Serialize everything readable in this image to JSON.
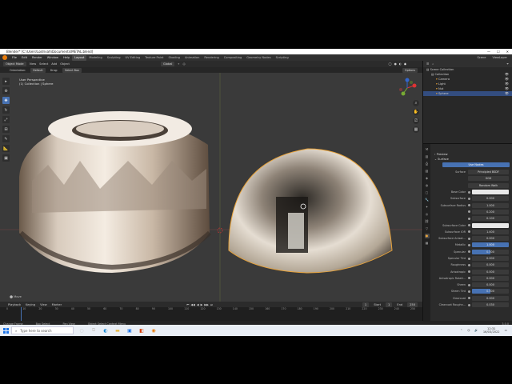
{
  "window": {
    "title": "Blender* [C:\\Users\\Lodrivah\\Documents\\METAL.blend]"
  },
  "menu": {
    "items": [
      "File",
      "Edit",
      "Render",
      "Window",
      "Help"
    ],
    "workspaces": [
      "Layout",
      "Modeling",
      "Sculpting",
      "UV Editing",
      "Texture Paint",
      "Shading",
      "Animation",
      "Rendering",
      "Compositing",
      "Geometry Nodes",
      "Scripting"
    ],
    "active_workspace": "Layout",
    "scene": "Scene",
    "view_layer": "ViewLayer"
  },
  "viewport_header": {
    "mode": "Object Mode",
    "menus": [
      "View",
      "Select",
      "Add",
      "Object"
    ],
    "transform": "Global",
    "options": "Options"
  },
  "tool_header": {
    "orientation": "Orientation:",
    "orientation_value": "Default",
    "drag": "Drag:",
    "drag_value": "Select Box"
  },
  "viewport": {
    "perspective": "User Perspective",
    "collection": "(1) Collection | Sphere",
    "mouse_label": "Move"
  },
  "outliner": {
    "root": "Scene Collection",
    "items": [
      {
        "label": "Collection",
        "indent": 1
      },
      {
        "label": "Camera",
        "indent": 2
      },
      {
        "label": "Light",
        "indent": 2
      },
      {
        "label": "Nut",
        "indent": 2
      },
      {
        "label": "Sphere",
        "indent": 2,
        "selected": true
      }
    ]
  },
  "properties": {
    "preview": "Preview",
    "surface_section": "Surface",
    "use_nodes": "Use Nodes",
    "surface": {
      "label": "Surface",
      "value": "Principled BSDF"
    },
    "distribution": "GGX",
    "subsurface_method": "Random Walk",
    "rows": [
      {
        "label": "Base Color",
        "value": "",
        "type": "white"
      },
      {
        "label": "Subsurface",
        "value": "0.000",
        "type": "dark"
      },
      {
        "label": "Subsurface Radius",
        "value": "1.000",
        "type": "dark"
      },
      {
        "label": "",
        "value": "0.200",
        "type": "dark"
      },
      {
        "label": "",
        "value": "0.100",
        "type": "dark"
      },
      {
        "label": "Subsurface Color",
        "value": "",
        "type": "white"
      },
      {
        "label": "Subsurface IOR",
        "value": "1.400",
        "type": "dark"
      },
      {
        "label": "Subsurface Anisot...",
        "value": "0.000",
        "type": "dark"
      },
      {
        "label": "Metallic",
        "value": "1.000",
        "type": "blue"
      },
      {
        "label": "Specular",
        "value": "0.500",
        "type": "half"
      },
      {
        "label": "Specular Tint",
        "value": "0.000",
        "type": "dark"
      },
      {
        "label": "Roughness",
        "value": "0.000",
        "type": "dark"
      },
      {
        "label": "Anisotropic",
        "value": "0.000",
        "type": "dark"
      },
      {
        "label": "Anisotropic Rotati...",
        "value": "0.000",
        "type": "dark"
      },
      {
        "label": "Sheen",
        "value": "0.000",
        "type": "dark"
      },
      {
        "label": "Sheen Tint",
        "value": "0.500",
        "type": "half"
      },
      {
        "label": "Clearcoat",
        "value": "0.000",
        "type": "dark"
      },
      {
        "label": "Clearcoat Roughn...",
        "value": "0.030",
        "type": "dark"
      }
    ]
  },
  "timeline": {
    "menus": [
      "Playback",
      "Keying",
      "View",
      "Marker"
    ],
    "current_frame": "1",
    "start_label": "Start",
    "start": "1",
    "end_label": "End",
    "end": "250",
    "ticks": [
      "0",
      "10",
      "20",
      "30",
      "40",
      "50",
      "60",
      "70",
      "80",
      "90",
      "100",
      "110",
      "120",
      "130",
      "140",
      "150",
      "160",
      "170",
      "180",
      "190",
      "200",
      "210",
      "220",
      "230",
      "240",
      "250"
    ]
  },
  "statusbar": {
    "items": [
      "Change Frame",
      "Box Select",
      "Pan View",
      "Object Select Context Menu"
    ],
    "version": "3.0.0"
  },
  "taskbar": {
    "search_placeholder": "Type here to search",
    "time": "12:31",
    "date": "16/03/2022"
  },
  "colors": {
    "accent": "#4772b3",
    "selection": "#e8a33b"
  }
}
